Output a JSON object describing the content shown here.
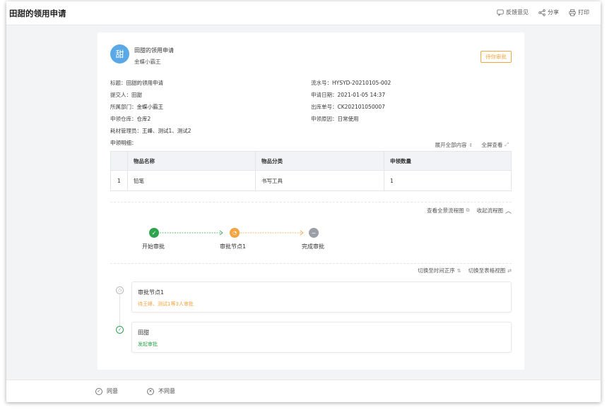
{
  "header": {
    "title": "田甜的领用申请",
    "actions": [
      {
        "label": "反馈意见",
        "icon": "feedback-icon"
      },
      {
        "label": "分享",
        "icon": "share-icon"
      },
      {
        "label": "打印",
        "icon": "print-icon"
      }
    ]
  },
  "request": {
    "avatar_text": "甜",
    "title": "田甜的领用申请",
    "subtitle": "金蝶小霸王",
    "status": "待你审批",
    "colors": {
      "avatar": "#5aa9e6",
      "status": "#f5a442",
      "success": "#2ea44f",
      "pending": "#f5a442",
      "idle": "#9aa0a6"
    }
  },
  "fields": {
    "title_k": "标题：",
    "title_v": "田甜的领用申请",
    "serial_k": "流水号：",
    "serial_v": "HYSYD-20210105-002",
    "submitter_k": "提交人：",
    "submitter_v": "田甜",
    "date_k": "申请日期：",
    "date_v": "2021-01-05 14:37",
    "dept_k": "所属部门：",
    "dept_v": "金蝶小霸王",
    "outbound_k": "出库单号：",
    "outbound_v": "CK202101050007",
    "warehouse_k": "申领仓库：",
    "warehouse_v": "仓库2",
    "reason_k": "申领原因：",
    "reason_v": "日常使用",
    "admin_k": "耗材管理员：",
    "admin_v": "王峰、测试1、测试2",
    "detail_k": "申领明细："
  },
  "table": {
    "tools": {
      "expand": "展开全部内容",
      "fullscreen": "全屏查看"
    },
    "columns": [
      "",
      "物品名称",
      "物品分类",
      "申领数量"
    ],
    "rows": [
      {
        "index": "1",
        "name": "铅笔",
        "category": "书写工具",
        "qty": "1"
      }
    ]
  },
  "flow": {
    "tools": {
      "full_view": "查看全景流程图",
      "collapse": "收起流程图"
    },
    "nodes": [
      {
        "label": "开始审批",
        "state": "done"
      },
      {
        "label": "审批节点1",
        "state": "current"
      },
      {
        "label": "完成审批",
        "state": "idle"
      }
    ]
  },
  "timeline": {
    "tools": {
      "time_order": "切换至时间正序",
      "table_view": "切换至表格视图"
    },
    "items": [
      {
        "name": "审批节点1",
        "desc": "待王峰、测试1等3人审批",
        "state": "pending"
      },
      {
        "name": "田甜",
        "desc": "发起审批",
        "state": "done"
      }
    ]
  },
  "footer": {
    "agree": "同意",
    "disagree": "不同意"
  }
}
